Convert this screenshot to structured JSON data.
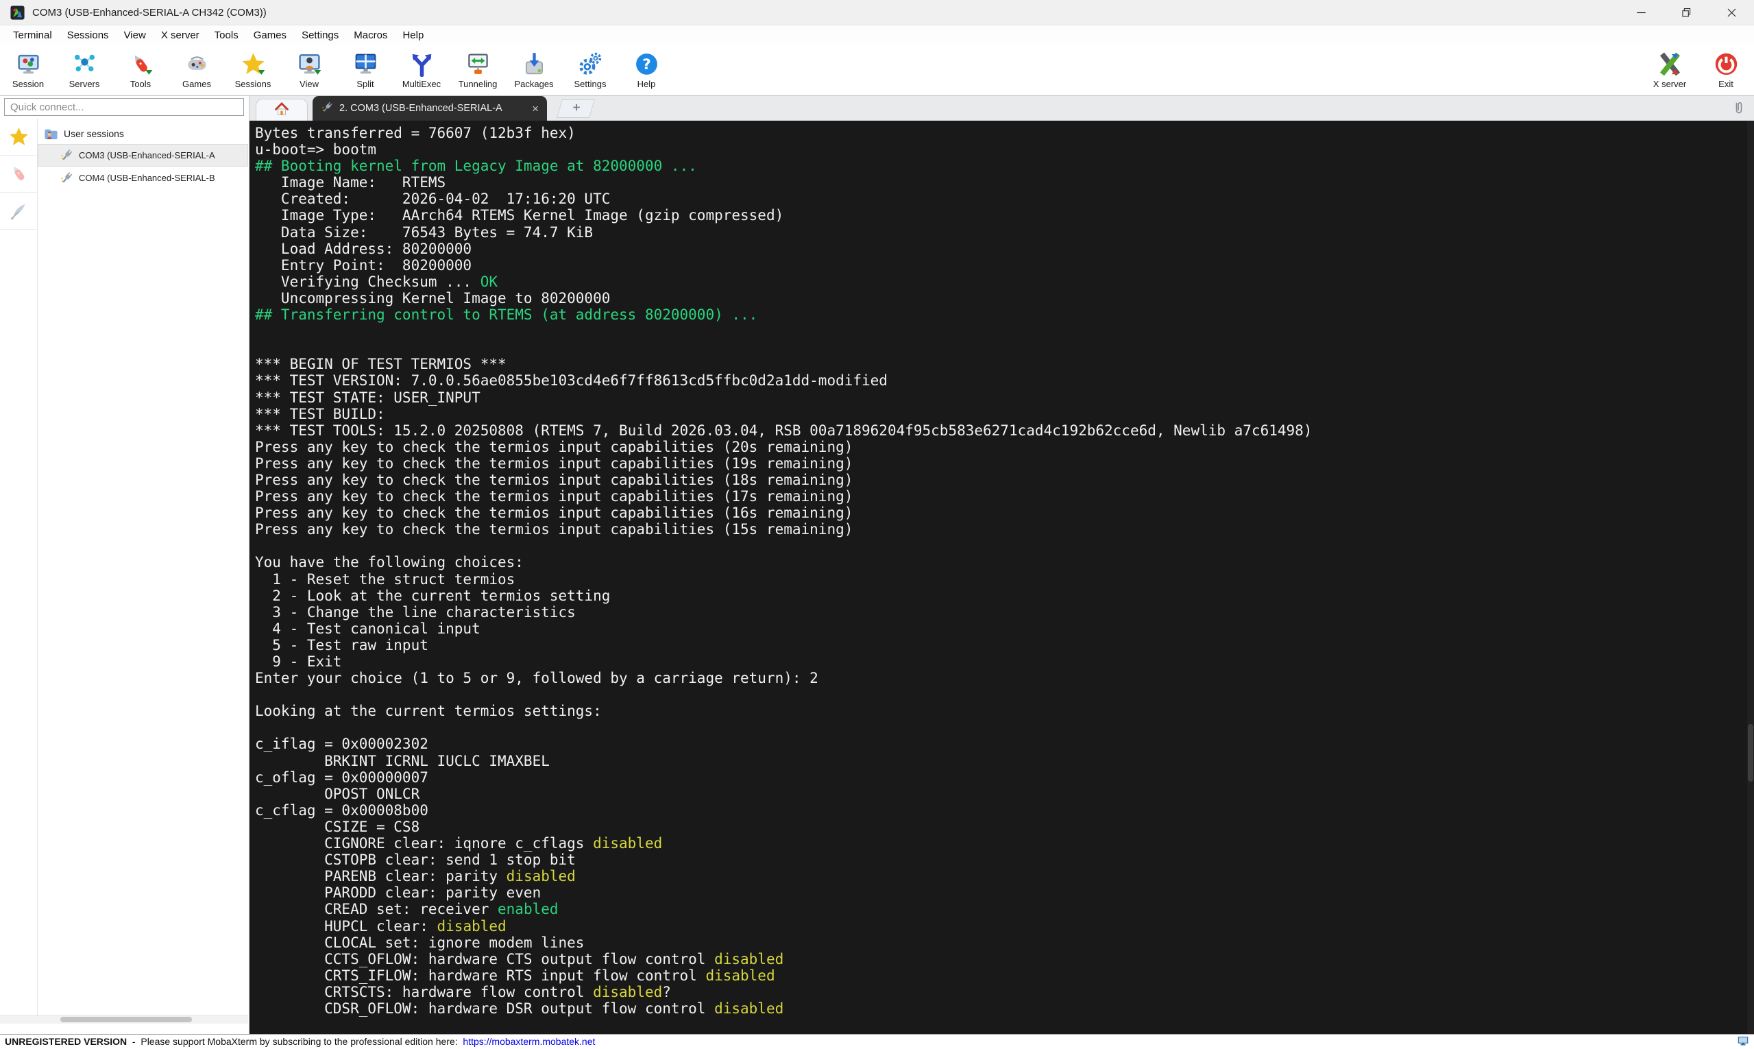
{
  "window": {
    "title": "COM3  (USB-Enhanced-SERIAL-A CH342 (COM3))",
    "controls": [
      {
        "name": "minimize",
        "icon": "minimize"
      },
      {
        "name": "restore",
        "icon": "restore"
      },
      {
        "name": "close",
        "icon": "close"
      }
    ]
  },
  "menu": {
    "items": [
      "Terminal",
      "Sessions",
      "View",
      "X server",
      "Tools",
      "Games",
      "Settings",
      "Macros",
      "Help"
    ]
  },
  "toolbar": {
    "buttons": [
      {
        "label": "Session",
        "icon": "session-monitor"
      },
      {
        "label": "Servers",
        "icon": "servers-network"
      },
      {
        "label": "Tools",
        "icon": "tools-knife"
      },
      {
        "label": "Games",
        "icon": "games-gamepad"
      },
      {
        "label": "Sessions",
        "icon": "sessions-star"
      },
      {
        "label": "View",
        "icon": "view-monitor"
      },
      {
        "label": "Split",
        "icon": "split-window"
      },
      {
        "label": "MultiExec",
        "icon": "multiexec-fork"
      },
      {
        "label": "Tunneling",
        "icon": "tunneling-monitor"
      },
      {
        "label": "Packages",
        "icon": "packages-box"
      },
      {
        "label": "Settings",
        "icon": "settings-gears"
      },
      {
        "label": "Help",
        "icon": "help-question"
      }
    ],
    "right_buttons": [
      {
        "label": "X server",
        "icon": "xserver-logo"
      },
      {
        "label": "Exit",
        "icon": "exit-power"
      }
    ]
  },
  "sidebar": {
    "quick_connect_placeholder": "Quick connect...",
    "rail": [
      {
        "icon": "star",
        "active": true
      },
      {
        "icon": "knife",
        "active": false
      },
      {
        "icon": "feather",
        "active": false
      }
    ],
    "tree": {
      "root": {
        "label": "User sessions",
        "icon": "folder-user"
      },
      "sessions": [
        {
          "label": "COM3  (USB-Enhanced-SERIAL-A",
          "icon": "plug",
          "selected": true
        },
        {
          "label": "COM4  (USB-Enhanced-SERIAL-B",
          "icon": "plug",
          "selected": false
        }
      ]
    }
  },
  "tabs": {
    "active": {
      "label": "2. COM3  (USB-Enhanced-SERIAL-A",
      "icon": "plug",
      "close_glyph": "×"
    }
  },
  "terminal": {
    "background": "#191919",
    "colors": {
      "w": "#f1f1f1",
      "g": "#2bd37e",
      "y": "#d6d63e"
    },
    "lines": [
      [
        [
          "w",
          "Bytes transferred = 76607 (12b3f hex)"
        ]
      ],
      [
        [
          "w",
          "u-boot=> bootm"
        ]
      ],
      [
        [
          "g",
          "## Booting kernel from Legacy Image at 82000000 ..."
        ]
      ],
      [
        [
          "w",
          "   Image Name:   RTEMS"
        ]
      ],
      [
        [
          "w",
          "   Created:      2026-04-02  17:16:20 UTC"
        ]
      ],
      [
        [
          "w",
          "   Image Type:   AArch64 RTEMS Kernel Image (gzip compressed)"
        ]
      ],
      [
        [
          "w",
          "   Data Size:    76543 Bytes = 74.7 KiB"
        ]
      ],
      [
        [
          "w",
          "   Load Address: 80200000"
        ]
      ],
      [
        [
          "w",
          "   Entry Point:  80200000"
        ]
      ],
      [
        [
          "w",
          "   Verifying Checksum ... "
        ],
        [
          "g",
          "OK"
        ]
      ],
      [
        [
          "w",
          "   Uncompressing Kernel Image to 80200000"
        ]
      ],
      [
        [
          "g",
          "## Transferring control to RTEMS (at address 80200000) ..."
        ]
      ],
      [],
      [],
      [
        [
          "w",
          "*** BEGIN OF TEST TERMIOS ***"
        ]
      ],
      [
        [
          "w",
          "*** TEST VERSION: 7.0.0.56ae0855be103cd4e6f7ff8613cd5ffbc0d2a1dd-modified"
        ]
      ],
      [
        [
          "w",
          "*** TEST STATE: USER_INPUT"
        ]
      ],
      [
        [
          "w",
          "*** TEST BUILD:"
        ]
      ],
      [
        [
          "w",
          "*** TEST TOOLS: 15.2.0 20250808 (RTEMS 7, Build 2026.03.04, RSB 00a71896204f95cb583e6271cad4c192b62cce6d, Newlib a7c61498)"
        ]
      ],
      [
        [
          "w",
          "Press any key to check the termios input capabilities (20s remaining)"
        ]
      ],
      [
        [
          "w",
          "Press any key to check the termios input capabilities (19s remaining)"
        ]
      ],
      [
        [
          "w",
          "Press any key to check the termios input capabilities (18s remaining)"
        ]
      ],
      [
        [
          "w",
          "Press any key to check the termios input capabilities (17s remaining)"
        ]
      ],
      [
        [
          "w",
          "Press any key to check the termios input capabilities (16s remaining)"
        ]
      ],
      [
        [
          "w",
          "Press any key to check the termios input capabilities (15s remaining)"
        ]
      ],
      [],
      [
        [
          "w",
          "You have the following choices:"
        ]
      ],
      [
        [
          "w",
          "  1 - Reset the struct termios"
        ]
      ],
      [
        [
          "w",
          "  2 - Look at the current termios setting"
        ]
      ],
      [
        [
          "w",
          "  3 - Change the line characteristics"
        ]
      ],
      [
        [
          "w",
          "  4 - Test canonical input"
        ]
      ],
      [
        [
          "w",
          "  5 - Test raw input"
        ]
      ],
      [
        [
          "w",
          "  9 - Exit"
        ]
      ],
      [
        [
          "w",
          "Enter your choice (1 to 5 or 9, followed by a carriage return): 2"
        ]
      ],
      [],
      [
        [
          "w",
          "Looking at the current termios settings:"
        ]
      ],
      [],
      [
        [
          "w",
          "c_iflag = 0x00002302"
        ]
      ],
      [
        [
          "w",
          "        BRKINT ICRNL IUCLC IMAXBEL"
        ]
      ],
      [
        [
          "w",
          "c_oflag = 0x00000007"
        ]
      ],
      [
        [
          "w",
          "        OPOST ONLCR"
        ]
      ],
      [
        [
          "w",
          "c_cflag = 0x00008b00"
        ]
      ],
      [
        [
          "w",
          "        CSIZE = CS8"
        ]
      ],
      [
        [
          "w",
          "        CIGNORE clear: iqnore c_cflags "
        ],
        [
          "y",
          "disabled"
        ]
      ],
      [
        [
          "w",
          "        CSTOPB clear: send 1 stop bit"
        ]
      ],
      [
        [
          "w",
          "        PARENB clear: parity "
        ],
        [
          "y",
          "disabled"
        ]
      ],
      [
        [
          "w",
          "        PARODD clear: parity even"
        ]
      ],
      [
        [
          "w",
          "        CREAD set: receiver "
        ],
        [
          "g",
          "enabled"
        ]
      ],
      [
        [
          "w",
          "        HUPCL clear: "
        ],
        [
          "y",
          "disabled"
        ]
      ],
      [
        [
          "w",
          "        CLOCAL set: ignore modem lines"
        ]
      ],
      [
        [
          "w",
          "        CCTS_OFLOW: hardware CTS output flow control "
        ],
        [
          "y",
          "disabled"
        ]
      ],
      [
        [
          "w",
          "        CRTS_IFLOW: hardware RTS input flow control "
        ],
        [
          "y",
          "disabled"
        ]
      ],
      [
        [
          "w",
          "        CRTSCTS: hardware flow control "
        ],
        [
          "y",
          "disabled"
        ],
        [
          "w",
          "?"
        ]
      ],
      [
        [
          "w",
          "        CDSR_OFLOW: hardware DSR output flow control "
        ],
        [
          "y",
          "disabled"
        ]
      ]
    ]
  },
  "statusbar": {
    "bold": "UNREGISTERED VERSION",
    "text": "  -  Please support MobaXterm by subscribing to the professional edition here:  ",
    "link": "https://mobaxterm.mobatek.net",
    "link_color": "#0000e8"
  }
}
